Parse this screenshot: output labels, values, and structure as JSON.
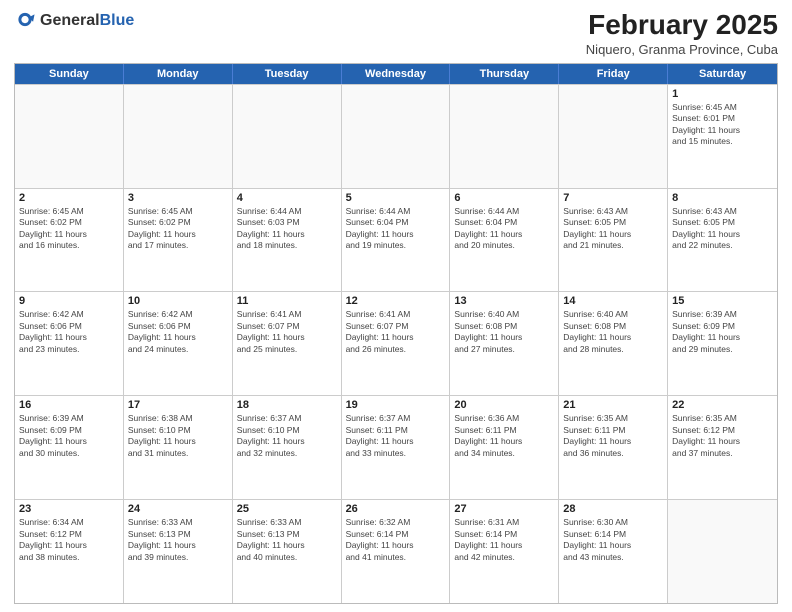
{
  "header": {
    "logo_general": "General",
    "logo_blue": "Blue",
    "title": "February 2025",
    "subtitle": "Niquero, Granma Province, Cuba"
  },
  "weekdays": [
    "Sunday",
    "Monday",
    "Tuesday",
    "Wednesday",
    "Thursday",
    "Friday",
    "Saturday"
  ],
  "weeks": [
    [
      {
        "day": "",
        "info": ""
      },
      {
        "day": "",
        "info": ""
      },
      {
        "day": "",
        "info": ""
      },
      {
        "day": "",
        "info": ""
      },
      {
        "day": "",
        "info": ""
      },
      {
        "day": "",
        "info": ""
      },
      {
        "day": "1",
        "info": "Sunrise: 6:45 AM\nSunset: 6:01 PM\nDaylight: 11 hours\nand 15 minutes."
      }
    ],
    [
      {
        "day": "2",
        "info": "Sunrise: 6:45 AM\nSunset: 6:02 PM\nDaylight: 11 hours\nand 16 minutes."
      },
      {
        "day": "3",
        "info": "Sunrise: 6:45 AM\nSunset: 6:02 PM\nDaylight: 11 hours\nand 17 minutes."
      },
      {
        "day": "4",
        "info": "Sunrise: 6:44 AM\nSunset: 6:03 PM\nDaylight: 11 hours\nand 18 minutes."
      },
      {
        "day": "5",
        "info": "Sunrise: 6:44 AM\nSunset: 6:04 PM\nDaylight: 11 hours\nand 19 minutes."
      },
      {
        "day": "6",
        "info": "Sunrise: 6:44 AM\nSunset: 6:04 PM\nDaylight: 11 hours\nand 20 minutes."
      },
      {
        "day": "7",
        "info": "Sunrise: 6:43 AM\nSunset: 6:05 PM\nDaylight: 11 hours\nand 21 minutes."
      },
      {
        "day": "8",
        "info": "Sunrise: 6:43 AM\nSunset: 6:05 PM\nDaylight: 11 hours\nand 22 minutes."
      }
    ],
    [
      {
        "day": "9",
        "info": "Sunrise: 6:42 AM\nSunset: 6:06 PM\nDaylight: 11 hours\nand 23 minutes."
      },
      {
        "day": "10",
        "info": "Sunrise: 6:42 AM\nSunset: 6:06 PM\nDaylight: 11 hours\nand 24 minutes."
      },
      {
        "day": "11",
        "info": "Sunrise: 6:41 AM\nSunset: 6:07 PM\nDaylight: 11 hours\nand 25 minutes."
      },
      {
        "day": "12",
        "info": "Sunrise: 6:41 AM\nSunset: 6:07 PM\nDaylight: 11 hours\nand 26 minutes."
      },
      {
        "day": "13",
        "info": "Sunrise: 6:40 AM\nSunset: 6:08 PM\nDaylight: 11 hours\nand 27 minutes."
      },
      {
        "day": "14",
        "info": "Sunrise: 6:40 AM\nSunset: 6:08 PM\nDaylight: 11 hours\nand 28 minutes."
      },
      {
        "day": "15",
        "info": "Sunrise: 6:39 AM\nSunset: 6:09 PM\nDaylight: 11 hours\nand 29 minutes."
      }
    ],
    [
      {
        "day": "16",
        "info": "Sunrise: 6:39 AM\nSunset: 6:09 PM\nDaylight: 11 hours\nand 30 minutes."
      },
      {
        "day": "17",
        "info": "Sunrise: 6:38 AM\nSunset: 6:10 PM\nDaylight: 11 hours\nand 31 minutes."
      },
      {
        "day": "18",
        "info": "Sunrise: 6:37 AM\nSunset: 6:10 PM\nDaylight: 11 hours\nand 32 minutes."
      },
      {
        "day": "19",
        "info": "Sunrise: 6:37 AM\nSunset: 6:11 PM\nDaylight: 11 hours\nand 33 minutes."
      },
      {
        "day": "20",
        "info": "Sunrise: 6:36 AM\nSunset: 6:11 PM\nDaylight: 11 hours\nand 34 minutes."
      },
      {
        "day": "21",
        "info": "Sunrise: 6:35 AM\nSunset: 6:11 PM\nDaylight: 11 hours\nand 36 minutes."
      },
      {
        "day": "22",
        "info": "Sunrise: 6:35 AM\nSunset: 6:12 PM\nDaylight: 11 hours\nand 37 minutes."
      }
    ],
    [
      {
        "day": "23",
        "info": "Sunrise: 6:34 AM\nSunset: 6:12 PM\nDaylight: 11 hours\nand 38 minutes."
      },
      {
        "day": "24",
        "info": "Sunrise: 6:33 AM\nSunset: 6:13 PM\nDaylight: 11 hours\nand 39 minutes."
      },
      {
        "day": "25",
        "info": "Sunrise: 6:33 AM\nSunset: 6:13 PM\nDaylight: 11 hours\nand 40 minutes."
      },
      {
        "day": "26",
        "info": "Sunrise: 6:32 AM\nSunset: 6:14 PM\nDaylight: 11 hours\nand 41 minutes."
      },
      {
        "day": "27",
        "info": "Sunrise: 6:31 AM\nSunset: 6:14 PM\nDaylight: 11 hours\nand 42 minutes."
      },
      {
        "day": "28",
        "info": "Sunrise: 6:30 AM\nSunset: 6:14 PM\nDaylight: 11 hours\nand 43 minutes."
      },
      {
        "day": "",
        "info": ""
      }
    ]
  ]
}
